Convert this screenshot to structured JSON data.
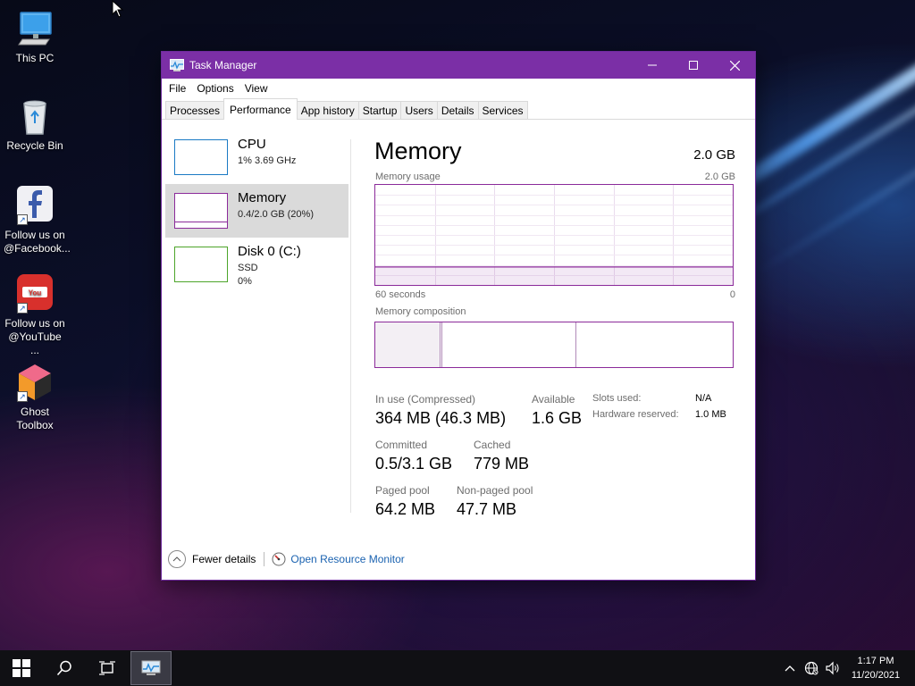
{
  "desktop": {
    "icons": [
      {
        "label_1": "This PC",
        "label_2": ""
      },
      {
        "label_1": "Recycle Bin",
        "label_2": ""
      },
      {
        "label_1": "Follow us on",
        "label_2": "@Facebook..."
      },
      {
        "label_1": "Follow us on",
        "label_2": "@YouTube ..."
      },
      {
        "label_1": "Ghost",
        "label_2": "Toolbox"
      }
    ]
  },
  "window": {
    "title": "Task Manager",
    "accent_color": "#7b2fa6",
    "menu": [
      "File",
      "Options",
      "View"
    ],
    "tabs": [
      "Processes",
      "Performance",
      "App history",
      "Startup",
      "Users",
      "Details",
      "Services"
    ],
    "active_tab": "Performance"
  },
  "sidebar": {
    "items": [
      {
        "name": "CPU",
        "sub_1": "1%  3.69 GHz",
        "sub_2": "",
        "color": "#1a7ac4"
      },
      {
        "name": "Memory",
        "sub_1": "0.4/2.0 GB (20%)",
        "sub_2": "",
        "color": "#8b2a9a"
      },
      {
        "name": "Disk 0 (C:)",
        "sub_1": "SSD",
        "sub_2": "0%",
        "color": "#4da52a"
      }
    ],
    "selected": "Memory"
  },
  "memory": {
    "heading": "Memory",
    "total": "2.0 GB",
    "usage_label": "Memory usage",
    "usage_max": "2.0 GB",
    "usage_fraction": 0.18,
    "x_left": "60 seconds",
    "x_right": "0",
    "composition_label": "Memory composition",
    "stats": {
      "in_use_label": "In use (Compressed)",
      "in_use_value": "364 MB (46.3 MB)",
      "available_label": "Available",
      "available_value": "1.6 GB",
      "committed_label": "Committed",
      "committed_value": "0.5/3.1 GB",
      "cached_label": "Cached",
      "cached_value": "779 MB",
      "paged_label": "Paged pool",
      "paged_value": "64.2 MB",
      "nonpaged_label": "Non-paged pool",
      "nonpaged_value": "47.7 MB",
      "slots_label": "Slots used:",
      "slots_value": "N/A",
      "hw_label": "Hardware reserved:",
      "hw_value": "1.0 MB"
    }
  },
  "footer": {
    "fewer_details": "Fewer details",
    "open_resource_monitor": "Open Resource Monitor"
  },
  "taskbar": {
    "time": "1:17 PM",
    "date": "11/20/2021"
  }
}
